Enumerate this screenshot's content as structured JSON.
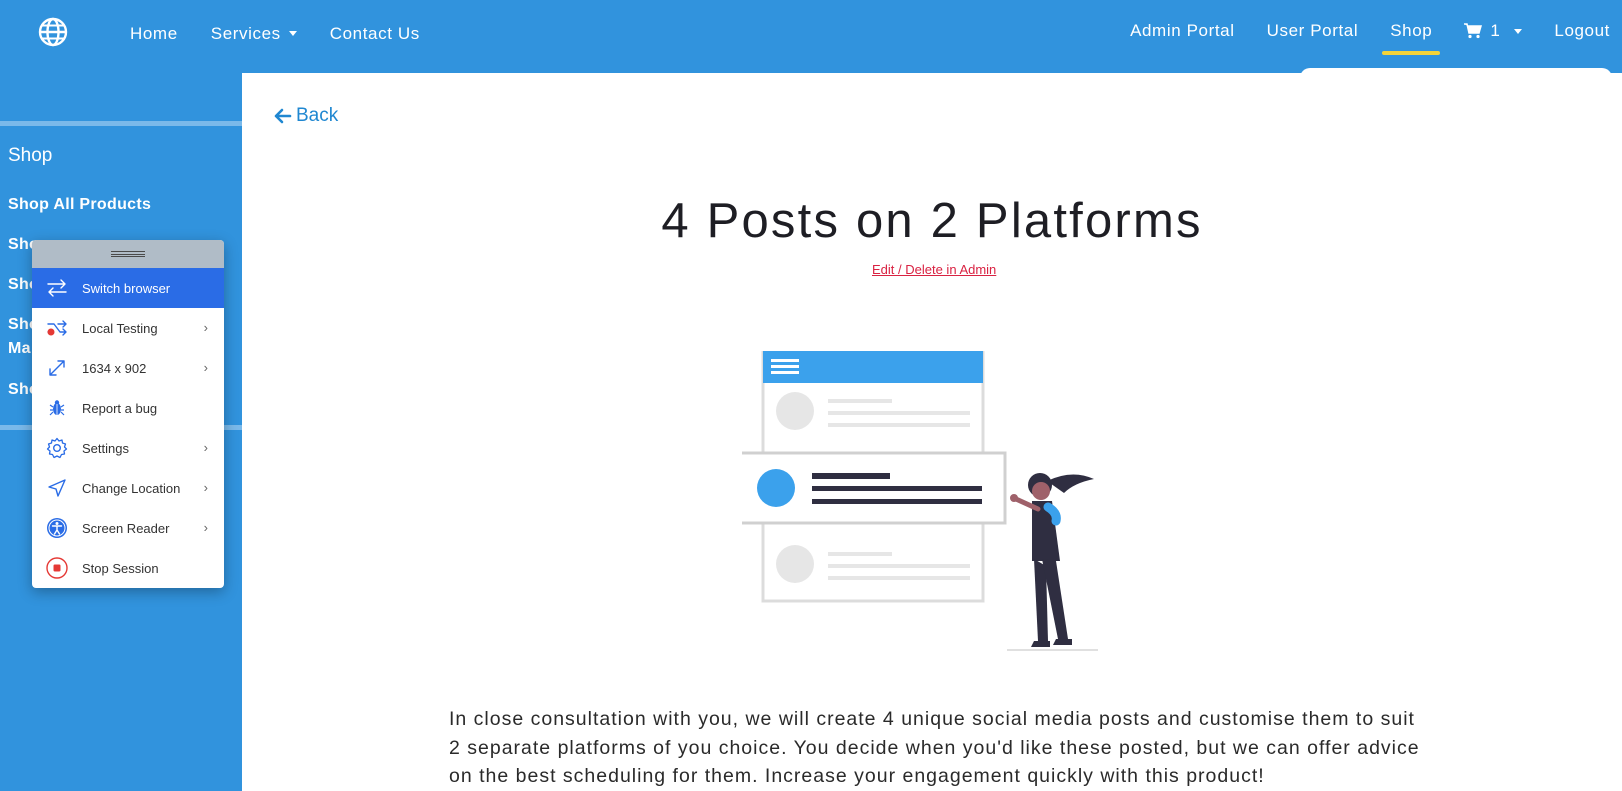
{
  "header": {
    "logo_icon": "globe-icon",
    "nav_left": [
      "Home",
      "Services",
      "Contact Us"
    ],
    "nav_right": [
      "Admin Portal",
      "User Portal",
      "Shop"
    ],
    "cart_count": "1",
    "logout": "Logout",
    "active": "Shop"
  },
  "sidebar": {
    "title": "Shop",
    "items": [
      "Shop All Products",
      "Sho",
      "Sho",
      "Sho",
      "Ma",
      "Sho"
    ]
  },
  "context_menu": {
    "items": [
      {
        "label": "Switch browser",
        "icon": "switch-arrows-icon",
        "active": true
      },
      {
        "label": "Local Testing",
        "icon": "local-testing-icon",
        "chevron": true
      },
      {
        "label": "1634 x 902",
        "icon": "resize-icon",
        "chevron": true
      },
      {
        "label": "Report a bug",
        "icon": "bug-icon"
      },
      {
        "label": "Settings",
        "icon": "gear-icon",
        "chevron": true
      },
      {
        "label": "Change Location",
        "icon": "location-arrow-icon",
        "chevron": true
      },
      {
        "label": "Screen Reader",
        "icon": "accessibility-icon",
        "chevron": true
      },
      {
        "label": "Stop Session",
        "icon": "stop-icon"
      }
    ]
  },
  "product": {
    "back_label": "Back",
    "title": "4 Posts on 2 Platforms",
    "edit_link": "Edit / Delete in Admin",
    "description": "In close consultation with you, we will create 4 unique social media posts and customise them to suit 2 separate platforms of you choice. You decide when you'd like these posted, but we can offer advice on the best scheduling for them. Increase your engagement quickly with this product!"
  },
  "colors": {
    "brand_blue": "#3193dd",
    "active_underline": "#f3d33a",
    "link_red": "#d92242",
    "menu_active": "#2a6ce6"
  }
}
